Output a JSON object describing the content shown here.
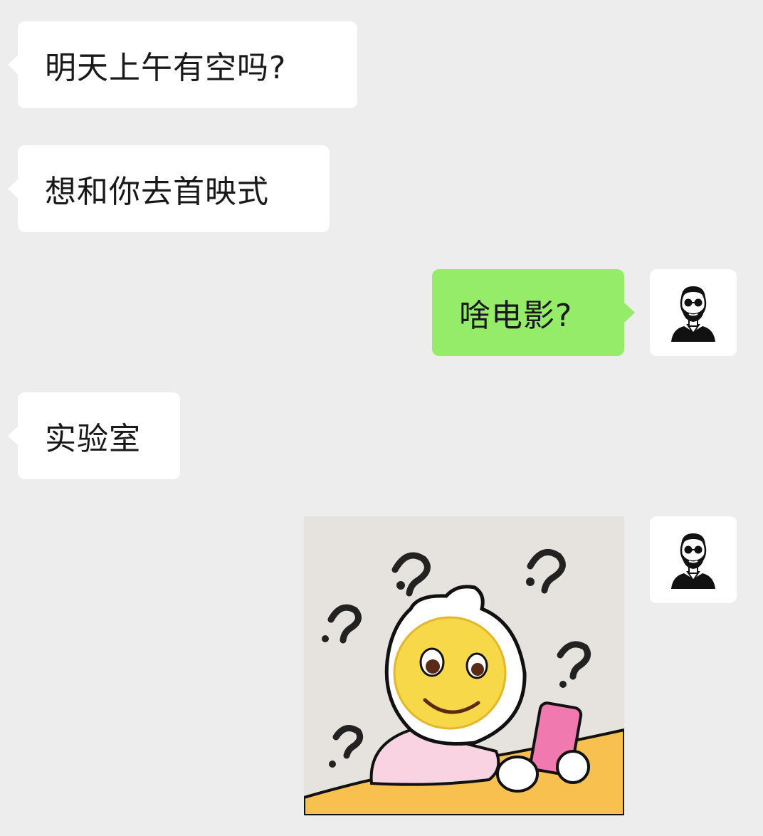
{
  "conversation": {
    "messages": [
      {
        "sender": "other",
        "type": "text",
        "text": "明天上午有空吗?"
      },
      {
        "sender": "other",
        "type": "text",
        "text": "想和你去首映式"
      },
      {
        "sender": "self",
        "type": "text",
        "text": "啥电影?"
      },
      {
        "sender": "other",
        "type": "text",
        "text": "实验室"
      },
      {
        "sender": "self",
        "type": "sticker",
        "sticker": "confused-smiley-phone-sticker"
      }
    ]
  },
  "avatars": {
    "self_icon": "bearded-man-sunglasses-icon"
  },
  "colors": {
    "background": "#ededed",
    "incoming_bubble": "#ffffff",
    "outgoing_bubble": "#95ec69",
    "text": "#191919"
  }
}
